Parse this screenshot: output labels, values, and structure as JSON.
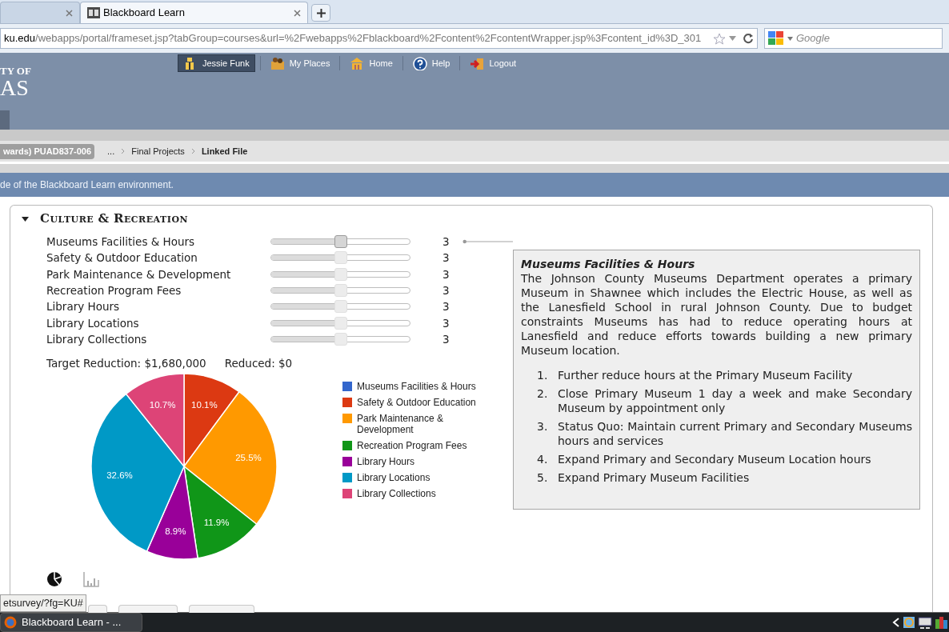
{
  "browser": {
    "tabs": [
      {
        "selected": false
      },
      {
        "label": "Blackboard Learn",
        "selected": true
      }
    ],
    "address": {
      "host": "ku.edu",
      "path": "/webapps/portal/frameset.jsp?tabGroup=courses&url=%2Fwebapps%2Fblackboard%2Fcontent%2FcontentWrapper.jsp%3Fcontent_id%3D_301"
    },
    "search": {
      "placeholder": "Google"
    }
  },
  "header": {
    "logo_lines": [
      "TY OF",
      "AS"
    ],
    "nav": [
      {
        "kind": "user",
        "label": "Jessie Funk",
        "selected": true
      },
      {
        "kind": "places",
        "label": "My Places",
        "selected": false
      },
      {
        "kind": "home",
        "label": "Home",
        "selected": false
      },
      {
        "kind": "help",
        "label": "Help",
        "selected": false
      },
      {
        "kind": "logout",
        "label": "Logout",
        "selected": false
      }
    ]
  },
  "breadcrumb": {
    "course": "wards) PUAD837-006",
    "items": [
      {
        "label": "...",
        "current": false
      },
      {
        "label": "Final Projects",
        "current": false
      },
      {
        "label": "Linked File",
        "current": true
      }
    ]
  },
  "banner": "de of the Blackboard Learn environment.",
  "section": {
    "title": "CULTURE & RECREATION",
    "expanded": true,
    "rows": [
      {
        "label": "Museums Facilities & Hours",
        "level": 0.5,
        "value": "3",
        "selected": true
      },
      {
        "label": "Safety & Outdoor Education",
        "level": 0.5,
        "value": "3",
        "selected": false
      },
      {
        "label": "Park Maintenance & Development",
        "level": 0.5,
        "value": "3",
        "selected": false
      },
      {
        "label": "Recreation Program Fees",
        "level": 0.5,
        "value": "3",
        "selected": false
      },
      {
        "label": "Library Hours",
        "level": 0.5,
        "value": "3",
        "selected": false
      },
      {
        "label": "Library Locations",
        "level": 0.5,
        "value": "3",
        "selected": false
      },
      {
        "label": "Library Collections",
        "level": 0.5,
        "value": "3",
        "selected": false
      }
    ],
    "target": "Target Reduction: $1,680,000",
    "reduced": "Reduced: $0",
    "chart_data": {
      "type": "pie",
      "categories": [
        "Museums Facilities & Hours",
        "Safety & Outdoor Education",
        "Park Maintenance & Development",
        "Recreation Program Fees",
        "Library Hours",
        "Library Locations",
        "Library Collections"
      ],
      "values": [
        0,
        10.1,
        25.5,
        11.9,
        8.9,
        32.6,
        10.7
      ],
      "colors": [
        "#3366cc",
        "#dc3912",
        "#ff9900",
        "#109618",
        "#990099",
        "#0099c6",
        "#dd4477"
      ],
      "value_labels": [
        null,
        "10.1%",
        "25.5%",
        "11.9%",
        "8.9%",
        "32.6%",
        "10.7%"
      ],
      "legend": "right"
    },
    "chart_types": [
      {
        "kind": "pie",
        "selected": true
      },
      {
        "kind": "bar",
        "selected": false
      }
    ],
    "detail": {
      "title": "Museums Facilities & Hours",
      "text": "The Johnson County Museums Department operates a primary Museum in Shawnee which includes the Electric House, as well as the Lanesfield School in rural Johnson County. Due to budget constraints Museums has had to reduce operating hours at Lanesfield and reduce efforts towards building a new primary Museum location.",
      "options": [
        {
          "number": "1.",
          "text": "Further reduce hours at the Primary Museum Facility"
        },
        {
          "number": "2.",
          "text": "Close Primary Museum 1 day a week and make Secondary Museum by appointment only"
        },
        {
          "number": "3.",
          "text": "Status Quo: Maintain current Primary and Secondary Museums hours and services"
        },
        {
          "number": "4.",
          "text": "Expand Primary and Secondary Museum Location hours"
        },
        {
          "number": "5.",
          "text": "Expand Primary Museum Facilities"
        }
      ]
    }
  },
  "status_url": "etsurvey/?fg=KU#",
  "taskbar": {
    "items": [
      {
        "label": "Blackboard Learn - ..."
      }
    ]
  }
}
